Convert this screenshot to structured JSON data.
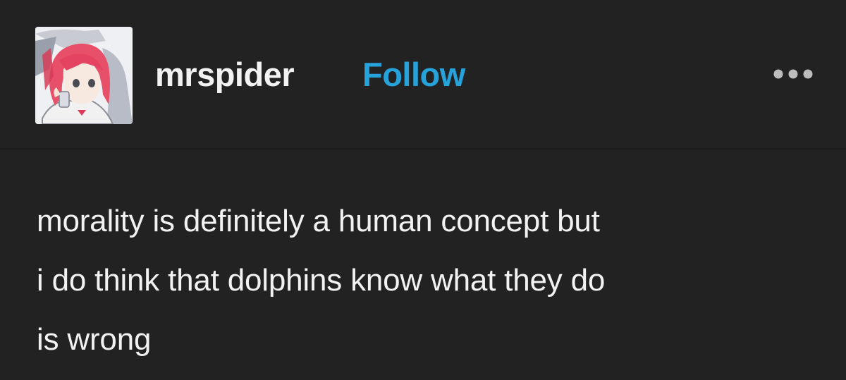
{
  "post": {
    "author": {
      "username": "mrspider",
      "avatar_icon": "avatar-illustration-icon"
    },
    "follow_label": "Follow",
    "more_icon": "ellipsis-icon",
    "body_lines": [
      "morality is definitely a human concept but",
      "i do think that dolphins know what they do",
      "is wrong"
    ]
  },
  "colors": {
    "background": "#222222",
    "text": "#f2f2f2",
    "accent": "#27a3dc"
  }
}
